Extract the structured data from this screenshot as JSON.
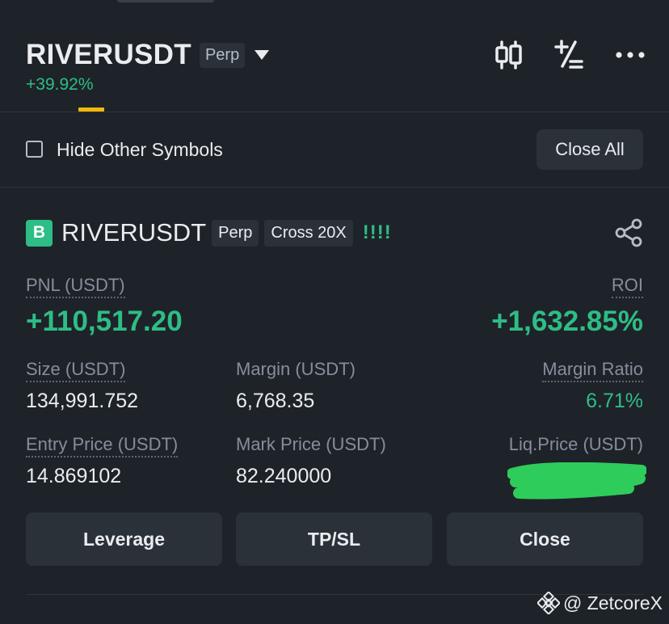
{
  "header": {
    "symbol": "RIVERUSDT",
    "contract_type": "Perp",
    "change_percent": "+39.92%",
    "icons": [
      "candlestick-chart-icon",
      "plus-minus-icon",
      "more-icon"
    ]
  },
  "filter": {
    "hide_other_symbols_label": "Hide Other Symbols",
    "hide_other_symbols_checked": false,
    "close_all_label": "Close All"
  },
  "position": {
    "side_badge": "B",
    "symbol": "RIVERUSDT",
    "contract_type": "Perp",
    "margin_mode": "Cross 20X",
    "adl_indicator": "!!!!",
    "pnl_label": "PNL (USDT)",
    "pnl_value": "+110,517.20",
    "roi_label": "ROI",
    "roi_value": "+1,632.85%",
    "size_label": "Size (USDT)",
    "size_value": "134,991.752",
    "margin_label": "Margin (USDT)",
    "margin_value": "6,768.35",
    "margin_ratio_label": "Margin Ratio",
    "margin_ratio_value": "6.71%",
    "entry_price_label": "Entry Price (USDT)",
    "entry_price_value": "14.869102",
    "mark_price_label": "Mark Price (USDT)",
    "mark_price_value": "82.240000",
    "liq_price_label": "Liq.Price (USDT)"
  },
  "actions": {
    "leverage_label": "Leverage",
    "tpsl_label": "TP/SL",
    "close_label": "Close"
  },
  "watermark": {
    "text": "@ ZetcoreX"
  },
  "colors": {
    "background": "#1e2329",
    "positive": "#2ebd85",
    "accent": "#f0b90b",
    "button": "#2b3139"
  }
}
